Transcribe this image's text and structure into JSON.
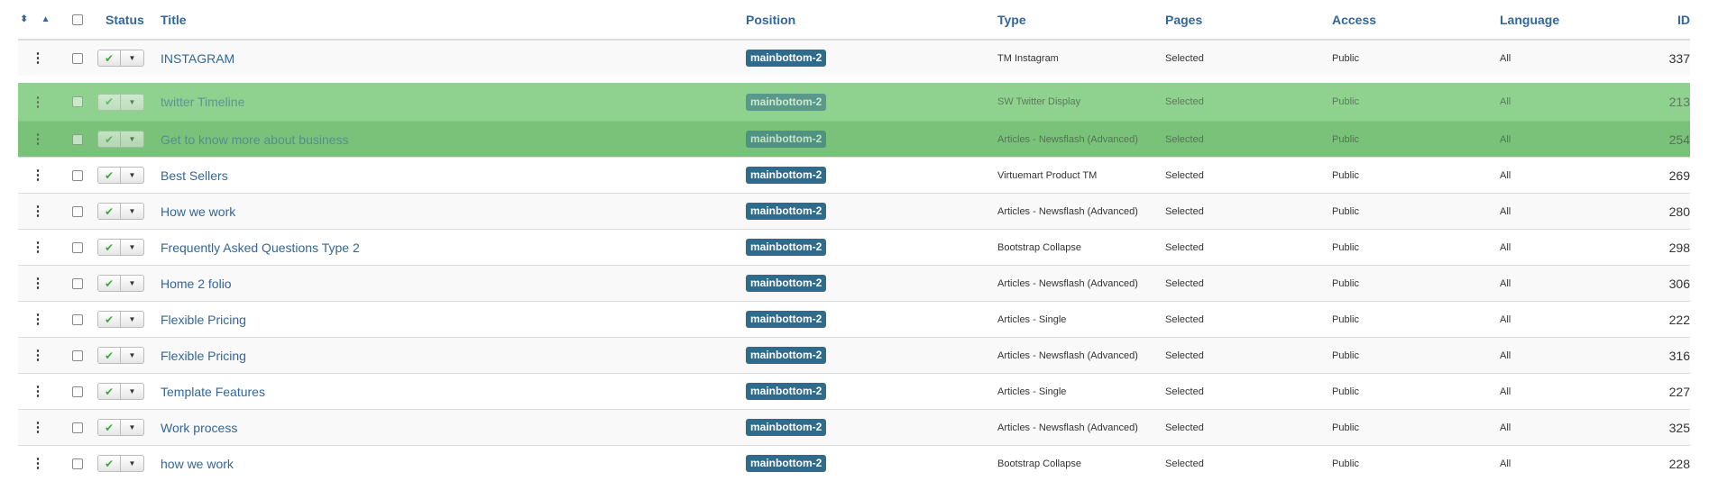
{
  "header": {
    "sort_icons": "⬍ ▲",
    "status": "Status",
    "title": "Title",
    "position": "Position",
    "type": "Type",
    "pages": "Pages",
    "access": "Access",
    "language": "Language",
    "id": "ID"
  },
  "icons": {
    "drag_handle": "⋮",
    "published": "✔",
    "dropdown": "▼"
  },
  "colors": {
    "link": "#336699",
    "badge": "#2f6b8a",
    "drag_highlight": "#8fd18f",
    "published_check": "#46a546"
  },
  "rows": [
    {
      "title": "INSTAGRAM",
      "position": "mainbottom-2",
      "type": "TM Instagram",
      "pages": "Selected",
      "access": "Public",
      "language": "All",
      "id": "337"
    },
    {
      "title": "twitter Timeline",
      "position": "mainbottom-2",
      "type": "SW Twitter Display",
      "pages": "Selected",
      "access": "Public",
      "language": "All",
      "id": "213"
    },
    {
      "title": "Get to know more about business",
      "position": "mainbottom-2",
      "type": "Articles - Newsflash (Advanced)",
      "pages": "Selected",
      "access": "Public",
      "language": "All",
      "id": "254"
    },
    {
      "title": "Best Sellers",
      "position": "mainbottom-2",
      "type": "Virtuemart Product TM",
      "pages": "Selected",
      "access": "Public",
      "language": "All",
      "id": "269"
    },
    {
      "title": "How we work",
      "position": "mainbottom-2",
      "type": "Articles - Newsflash (Advanced)",
      "pages": "Selected",
      "access": "Public",
      "language": "All",
      "id": "280"
    },
    {
      "title": "Frequently Asked Questions Type 2",
      "position": "mainbottom-2",
      "type": "Bootstrap Collapse",
      "pages": "Selected",
      "access": "Public",
      "language": "All",
      "id": "298"
    },
    {
      "title": "Home 2 folio",
      "position": "mainbottom-2",
      "type": "Articles - Newsflash (Advanced)",
      "pages": "Selected",
      "access": "Public",
      "language": "All",
      "id": "306"
    },
    {
      "title": "Flexible Pricing",
      "position": "mainbottom-2",
      "type": "Articles - Single",
      "pages": "Selected",
      "access": "Public",
      "language": "All",
      "id": "222"
    },
    {
      "title": "Flexible Pricing",
      "position": "mainbottom-2",
      "type": "Articles - Newsflash (Advanced)",
      "pages": "Selected",
      "access": "Public",
      "language": "All",
      "id": "316"
    },
    {
      "title": "Template Features",
      "position": "mainbottom-2",
      "type": "Articles - Single",
      "pages": "Selected",
      "access": "Public",
      "language": "All",
      "id": "227"
    },
    {
      "title": "Work process",
      "position": "mainbottom-2",
      "type": "Articles - Newsflash (Advanced)",
      "pages": "Selected",
      "access": "Public",
      "language": "All",
      "id": "325"
    },
    {
      "title": "how we work",
      "position": "mainbottom-2",
      "type": "Bootstrap Collapse",
      "pages": "Selected",
      "access": "Public",
      "language": "All",
      "id": "228"
    }
  ]
}
